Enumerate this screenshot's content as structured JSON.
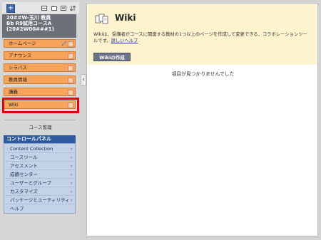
{
  "topbar": {
    "add_label": "+",
    "icons": [
      "grid-icon",
      "folder-icon",
      "window-icon",
      "sort-icon"
    ]
  },
  "course": {
    "lines": [
      "20##W-玉川 教員",
      "Bb R9試用コースA",
      "(20#2W00###1)"
    ]
  },
  "menu": [
    {
      "label": "ホームページ"
    },
    {
      "label": "アナウンス"
    },
    {
      "label": "シラバス"
    },
    {
      "label": "教員情報"
    },
    {
      "label": "講義"
    },
    {
      "label": "Wiki"
    }
  ],
  "course_management": {
    "heading": "コース管理",
    "control_panel_label": "コントロールパネル",
    "items": [
      {
        "label": "Content Collection"
      },
      {
        "label": "コースツール"
      },
      {
        "label": "アセスメント"
      },
      {
        "label": "成績センター"
      },
      {
        "label": "ユーザーとグループ"
      },
      {
        "label": "カスタマイズ"
      },
      {
        "label": "パッケージとユーティリティ"
      },
      {
        "label": "ヘルプ"
      }
    ]
  },
  "collapse_glyph": "‹",
  "main": {
    "title": "Wiki",
    "description_line1": "Wikiは、受講者がコースに関連する教材の1つ以上のページを作成して変更できる、コラボレーションツー",
    "description_line2_prefix": "ルです。",
    "help_link": "詳しいヘルプ",
    "create_button": "Wikiの作成",
    "empty_message": "項目が見つかりませんでした"
  },
  "colors": {
    "menu_orange": "#f7a45a",
    "control_panel_blue": "#2d5aa0",
    "highlight_red": "#e3000f",
    "header_band": "#fdf3cf"
  }
}
